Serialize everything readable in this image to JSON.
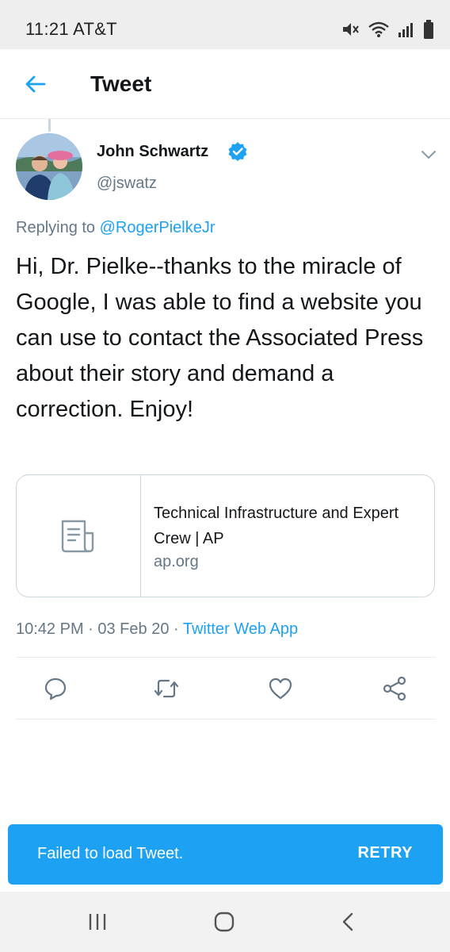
{
  "status_bar": {
    "time": "11:21",
    "carrier": "AT&T",
    "icons": [
      "mute-icon",
      "wifi-icon",
      "signal-icon",
      "battery-icon"
    ]
  },
  "header": {
    "title": "Tweet",
    "back_icon": "arrow-left-icon"
  },
  "tweet": {
    "author_name": "John Schwartz",
    "verified": true,
    "handle": "@jswatz",
    "reply_prefix": "Replying to",
    "reply_to": "@RogerPielkeJr",
    "text": "Hi, Dr. Pielke--thanks to the miracle of Google, I was able to find a website you can use to contact the Associated Press about their story and demand a correction. Enjoy!",
    "card": {
      "icon": "document-icon",
      "title": "Technical Infrastructure and Expert Crew | AP",
      "domain": "ap.org"
    },
    "timestamp": "10:42 PM · 03 Feb 20 · ",
    "source": "Twitter Web App",
    "actions": [
      "reply-icon",
      "retweet-icon",
      "like-icon",
      "share-icon"
    ]
  },
  "snackbar": {
    "message": "Failed to load Tweet.",
    "action": "RETRY"
  },
  "colors": {
    "accent": "#1da1f2",
    "text": "#14171a",
    "secondary_text": "#657786",
    "border": "#ccd6dd"
  }
}
